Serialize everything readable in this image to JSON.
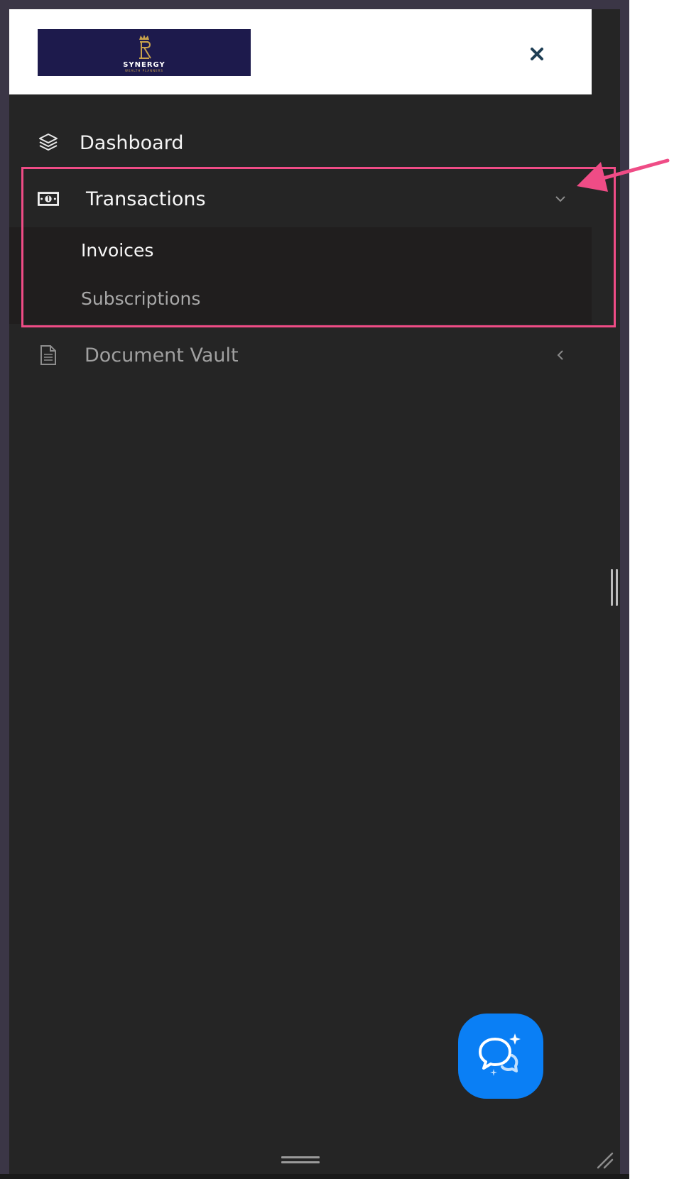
{
  "brand": {
    "name": "SYNERGY",
    "tagline": "WEALTH PLANNERS",
    "bg_color": "#1d1a4c",
    "accent_color": "#c9a34c"
  },
  "header": {
    "close_icon": "close-icon"
  },
  "nav": {
    "items": [
      {
        "label": "Dashboard",
        "icon": "layers-icon"
      },
      {
        "label": "Transactions",
        "icon": "money-bill-icon",
        "expanded": true,
        "children": [
          {
            "label": "Invoices",
            "active": true
          },
          {
            "label": "Subscriptions",
            "active": false
          }
        ]
      },
      {
        "label": "Document Vault",
        "icon": "document-icon",
        "expanded": false
      }
    ]
  },
  "annotation": {
    "color": "#ef4c86"
  },
  "chat": {
    "icon": "chat-sparkle-icon",
    "color": "#0a7ff5"
  }
}
